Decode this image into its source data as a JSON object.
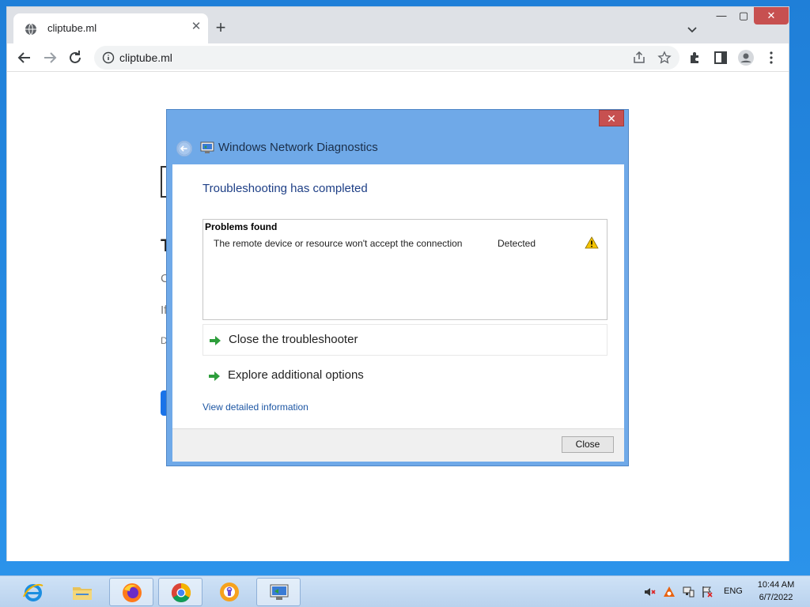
{
  "browser": {
    "tab_title": "cliptube.ml",
    "tab_close": "✕",
    "new_tab": "+",
    "url": "cliptube.ml",
    "win_minimize": "—",
    "win_maximize": "▢",
    "win_close": "✕"
  },
  "page_background_fragments": {
    "heading_letter": "T",
    "line1": "C",
    "line2": "If",
    "line3": "D"
  },
  "dialog": {
    "title": "Windows Network Diagnostics",
    "close_glyph": "✕",
    "heading": "Troubleshooting has completed",
    "problems_header": "Problems found",
    "problems": [
      {
        "text": "The remote device or resource won't accept the connection",
        "status": "Detected"
      }
    ],
    "actions": [
      "Close the troubleshooter",
      "Explore additional options"
    ],
    "detail_link": "View detailed information",
    "close_button": "Close"
  },
  "taskbar": {
    "apps": [
      "internet-explorer",
      "file-explorer",
      "firefox",
      "chrome",
      "brave-browser",
      "network-diagnostics"
    ],
    "language": "ENG",
    "time": "10:44 AM",
    "date": "6/7/2022"
  },
  "colors": {
    "dialog_frame": "#6fa9e8",
    "heading": "#1e3f86",
    "link": "#1e57a4",
    "warning": "#f5c400",
    "action_arrow": "#2e9e3c"
  }
}
